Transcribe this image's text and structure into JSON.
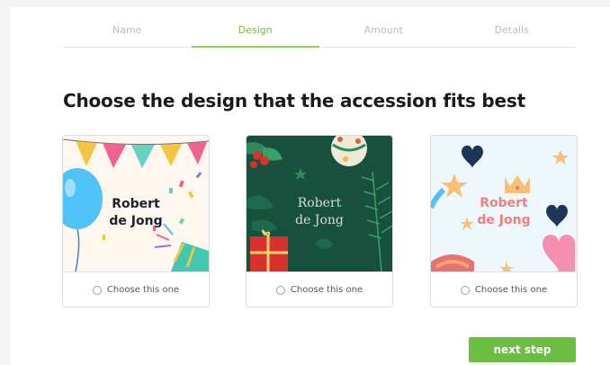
{
  "steps": [
    {
      "label": "Name",
      "active": false
    },
    {
      "label": "Design",
      "active": true
    },
    {
      "label": "Amount",
      "active": false
    },
    {
      "label": "Details",
      "active": false
    }
  ],
  "heading": "Choose the design that the accession fits best",
  "cards": [
    {
      "name_line1": "Robert",
      "name_line2": "de Jong",
      "choose_label": "Choose this one",
      "theme": "party",
      "background": "#fdf7ef"
    },
    {
      "name_line1": "Robert",
      "name_line2": "de Jong",
      "choose_label": "Choose this one",
      "theme": "christmas",
      "background": "#17503d"
    },
    {
      "name_line1": "Robert",
      "name_line2": "de Jong",
      "choose_label": "Choose this one",
      "theme": "love",
      "background": "#eef8fc"
    }
  ],
  "next_button": "next step",
  "colors": {
    "accent": "#6cbd43",
    "heading": "#1a1a1a"
  }
}
